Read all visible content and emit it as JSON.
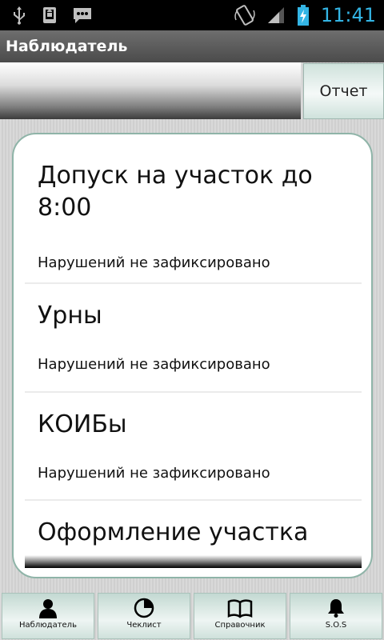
{
  "status_bar": {
    "time": "11:41",
    "icons": [
      "usb-icon",
      "android-debug-icon",
      "message-icon",
      "rotation-icon",
      "signal-icon",
      "battery-charging-icon"
    ],
    "accent_color": "#33b5e5"
  },
  "app": {
    "title": "Наблюдатель"
  },
  "top_panel": {
    "report_label": "Отчет"
  },
  "checklist": {
    "items": [
      {
        "title": "Допуск на участок до 8:00",
        "status": "Нарушений не зафиксировано"
      },
      {
        "title": "Урны",
        "status": "Нарушений не зафиксировано"
      },
      {
        "title": "КОИБы",
        "status": "Нарушений не зафиксировано"
      },
      {
        "title": "Оформление участка",
        "status": ""
      }
    ]
  },
  "bottom_nav": {
    "items": [
      {
        "label": "Наблюдатель",
        "icon": "person-icon"
      },
      {
        "label": "Чеклист",
        "icon": "pie-chart-icon"
      },
      {
        "label": "Справочник",
        "icon": "book-icon"
      },
      {
        "label": "S.O.S",
        "icon": "bell-icon"
      }
    ]
  },
  "colors": {
    "frame_border": "#8fb4a8",
    "button_tint": "#cfe2dc"
  }
}
